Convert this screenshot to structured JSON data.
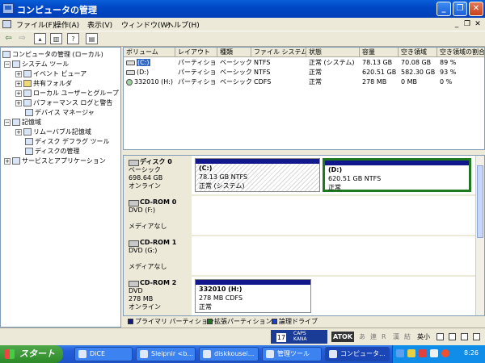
{
  "window": {
    "title": "コンピュータの管理"
  },
  "menu": [
    "ファイル(F)",
    "操作(A)",
    "表示(V)",
    "ウィンドウ(W)",
    "ヘルプ(H)"
  ],
  "tree": [
    {
      "label": "コンピュータの管理 (ローカル)"
    },
    {
      "label": "システム ツール"
    },
    {
      "label": "イベント ビューア"
    },
    {
      "label": "共有フォルダ"
    },
    {
      "label": "ローカル ユーザーとグループ"
    },
    {
      "label": "パフォーマンス ログと警告"
    },
    {
      "label": "デバイス マネージャ"
    },
    {
      "label": "記憶域"
    },
    {
      "label": "リムーバブル記憶域"
    },
    {
      "label": "ディスク デフラグ ツール"
    },
    {
      "label": "ディスクの管理"
    },
    {
      "label": "サービスとアプリケーション"
    }
  ],
  "volumes": {
    "headers": [
      "ボリューム",
      "レイアウト",
      "種類",
      "ファイル システム",
      "状態",
      "容量",
      "空き領域",
      "空き領域の割合"
    ],
    "rows": [
      [
        "(C:)",
        "パーティション",
        "ベーシック",
        "NTFS",
        "正常 (システム)",
        "78.13 GB",
        "70.08 GB",
        "89 %"
      ],
      [
        "(D:)",
        "パーティション",
        "ベーシック",
        "NTFS",
        "正常",
        "620.51 GB",
        "582.30 GB",
        "93 %"
      ],
      [
        "332010 (H:)",
        "パーティション",
        "ベーシック",
        "CDFS",
        "正常",
        "278 MB",
        "0 MB",
        "0 %"
      ]
    ]
  },
  "disks": [
    {
      "name": "ディスク 0",
      "type": "ベーシック",
      "size": "698.64 GB",
      "status": "オンライン",
      "partitions": [
        {
          "label": "(C:)",
          "detail": "78.13 GB NTFS",
          "status": "正常 (システム)"
        },
        {
          "label": "(D:)",
          "detail": "620.51 GB NTFS",
          "status": "正常"
        }
      ]
    },
    {
      "name": "CD-ROM 0",
      "type": "DVD (F:)",
      "size": "",
      "status": "メディアなし"
    },
    {
      "name": "CD-ROM 1",
      "type": "DVD (G:)",
      "size": "",
      "status": "メディアなし"
    },
    {
      "name": "CD-ROM 2",
      "type": "DVD",
      "size": "278 MB",
      "status": "オンライン",
      "partitions": [
        {
          "label": "332010 (H:)",
          "detail": "278 MB CDFS",
          "status": "正常"
        }
      ]
    }
  ],
  "legend": [
    "プライマリ パーティション",
    "拡張パーティション",
    "論理ドライブ"
  ],
  "legend_colors": [
    "#10188c",
    "#1f7a1f",
    "#1a3cd8"
  ],
  "ime": {
    "num": "17",
    "caps": "CAPS",
    "kana": "KANA"
  },
  "atok": {
    "label": "ATOK",
    "chars": [
      "あ",
      "連",
      "R",
      "漢",
      "結"
    ],
    "small": "英小"
  },
  "taskbar": {
    "start": "スタート",
    "tasks": [
      "DiCE",
      "Sleipnir <b...",
      "diskkousei...",
      "管理ツール",
      "コンピュータ..."
    ],
    "clock": "8:26"
  }
}
